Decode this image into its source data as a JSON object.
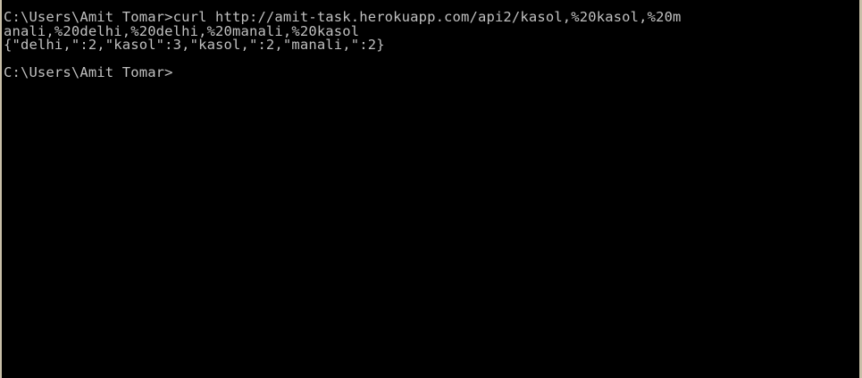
{
  "console": {
    "lines": [
      "C:\\Users\\Amit Tomar>curl http://amit-task.herokuapp.com/api2/kasol,%20kasol,%20m",
      "anali,%20delhi,%20delhi,%20manali,%20kasol",
      "{\"delhi,\":2,\"kasol\":3,\"kasol,\":2,\"manali,\":2}",
      "",
      "C:\\Users\\Amit Tomar>"
    ]
  },
  "colors": {
    "background": "#000000",
    "text": "#c0c0c0",
    "window_border": "#c8bfa8"
  }
}
